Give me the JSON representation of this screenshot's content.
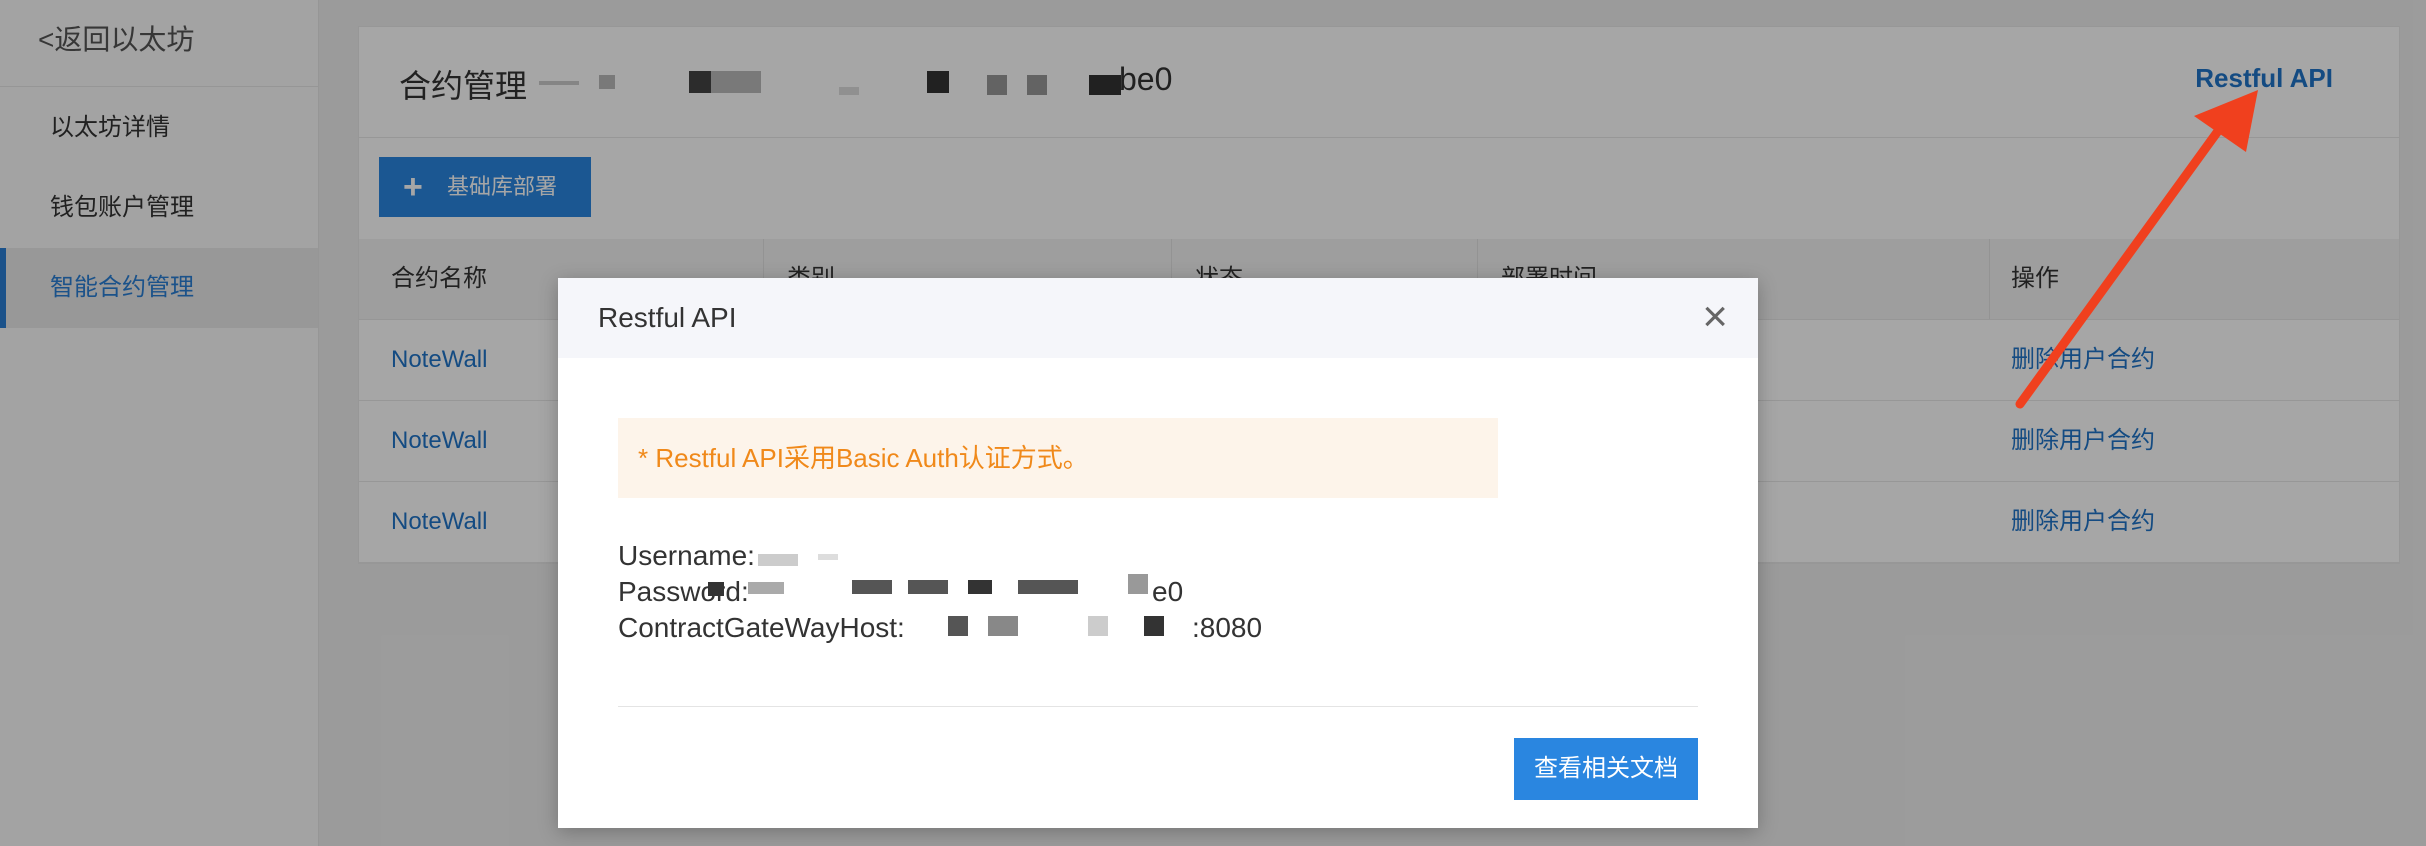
{
  "sidebar": {
    "back_label": "<返回以太坊",
    "items": [
      {
        "label": "以太坊详情"
      },
      {
        "label": "钱包账户管理"
      },
      {
        "label": "智能合约管理",
        "active": true
      }
    ]
  },
  "panel": {
    "title": "合约管理",
    "id_suffix": "be0",
    "restful_link": "Restful API",
    "add_button": "基础库部署"
  },
  "table": {
    "headers": [
      "合约名称",
      "类别",
      "状态",
      "部署时间",
      "操作"
    ],
    "rows": [
      {
        "name": "NoteWall",
        "action": "删除用户合约"
      },
      {
        "name": "NoteWall",
        "action": "删除用户合约"
      },
      {
        "name": "NoteWall",
        "action": "删除用户合约"
      }
    ]
  },
  "modal": {
    "title": "Restful API",
    "notice": "* Restful API采用Basic Auth认证方式。",
    "username_label": "Username:",
    "password_label": "Password:",
    "password_suffix": "e0",
    "host_label": "ContractGateWayHost:",
    "host_suffix": ":8080",
    "docs_button": "查看相关文档"
  },
  "colors": {
    "accent": "#2a86e0",
    "link": "#1f74c8",
    "notice_text": "#f0891a",
    "arrow": "#f0401e"
  }
}
